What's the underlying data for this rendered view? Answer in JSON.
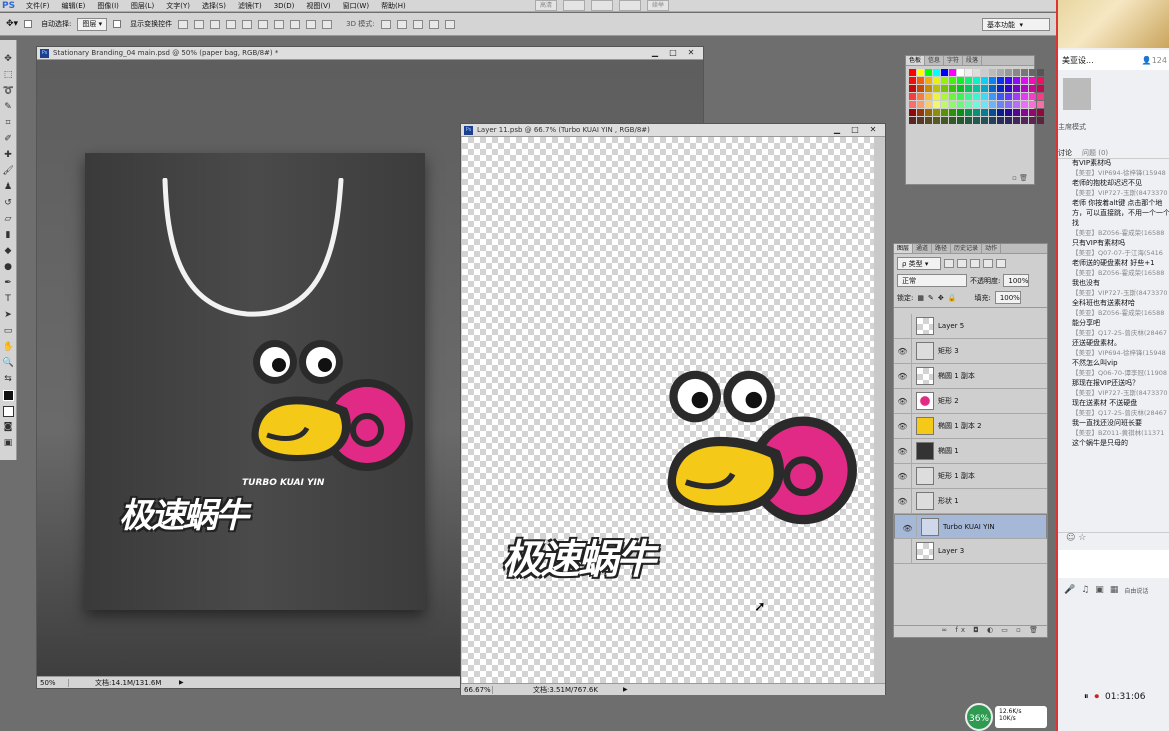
{
  "menubar": {
    "logo": "PS",
    "items": [
      "文件(F)",
      "编辑(E)",
      "图像(I)",
      "图层(L)",
      "文字(Y)",
      "选择(S)",
      "滤镜(T)",
      "3D(D)",
      "视图(V)",
      "窗口(W)",
      "帮助(H)"
    ],
    "top_buttons": [
      "高清",
      "",
      "",
      "",
      "续举"
    ]
  },
  "options": {
    "auto_select_label": "自动选择:",
    "auto_select_value": "图层",
    "transform_label": "显示变换控件",
    "mode_3d_label": "3D 模式:",
    "workspace": "基本功能"
  },
  "doc1": {
    "title": "Stationary Branding_04 main.psd @ 50% (paper bag, RGB/8#) *",
    "zoom": "50%",
    "info": "文档:14.1M/131.6M",
    "brand_en": "TURBO KUAI YIN",
    "brand_cn": "极速蜗牛"
  },
  "doc2": {
    "title": "Layer 11.psb @ 66.7% (Turbo KUAI YIN , RGB/8#)",
    "zoom": "66.67%",
    "info": "文档:3.51M/767.6K",
    "brand_cn": "极速蜗牛"
  },
  "swatches_panel": {
    "tabs": [
      "色板",
      "信息",
      "字符",
      "段落"
    ]
  },
  "layers_panel": {
    "tabs": [
      "图层",
      "通道",
      "路径",
      "历史记录",
      "动作"
    ],
    "kind_label": "ρ 类型",
    "blend_mode": "正常",
    "opacity_label": "不透明度:",
    "opacity_value": "100%",
    "lock_label": "锁定:",
    "fill_label": "填充:",
    "fill_value": "100%",
    "layers": [
      {
        "name": "Layer 5",
        "visible": false
      },
      {
        "name": "矩形 3",
        "visible": true
      },
      {
        "name": "椭圆 1 副本",
        "visible": true
      },
      {
        "name": "矩形 2",
        "visible": true
      },
      {
        "name": "椭圆 1 副本 2",
        "visible": true
      },
      {
        "name": "椭圆 1",
        "visible": true
      },
      {
        "name": "矩形 1 副本",
        "visible": true
      },
      {
        "name": "形状 1",
        "visible": true
      },
      {
        "name": "Turbo KUAI YIN",
        "visible": true,
        "selected": true
      },
      {
        "name": "Layer 3",
        "visible": false
      }
    ],
    "bottom_icons": "∞ fx ◘ ◐ ▭ ▫ 🗑"
  },
  "tray": {
    "cpu": "36%",
    "up": "12.6K/s",
    "down": "10K/s"
  },
  "side": {
    "title": "美亚设...",
    "count": "124",
    "mode_label": "主席模式",
    "tabs": [
      "讨论",
      "问题 (0)"
    ],
    "messages": [
      {
        "name": "",
        "text": "有VIP素材吗",
        "partial": true
      },
      {
        "name": "【美亚】VIP694-徐梓锋(15948",
        "text": "老师的抱枕却迟迟不见"
      },
      {
        "name": "【美亚】VIP727-玉斯(8473370",
        "text": "老师 你按着alt键 点击那个地方，可以直接跳，不用一个一个找"
      },
      {
        "name": "【美亚】BZ056-霍成荣(16588",
        "text": "只有VIP有素材吗"
      },
      {
        "name": "【美亚】Q07-07-于江海(5416",
        "text": "老师送的硬盘素材 好些+1"
      },
      {
        "name": "【美亚】BZ056-霍成荣(16588",
        "text": "我也没有"
      },
      {
        "name": "【美亚】VIP727-玉斯(8473370",
        "text": "全科班也有送素材哈"
      },
      {
        "name": "【美亚】BZ056-霍成荣(16588",
        "text": "能分享吧"
      },
      {
        "name": "【美亚】Q17-25-曾庆林(28467",
        "text": "还送硬盘素材。"
      },
      {
        "name": "【美亚】VIP694-徐梓锋(15948",
        "text": "不然怎么叫vip"
      },
      {
        "name": "【美亚】Q06-70-谭李冠(11908",
        "text": "那现在报VIP还送吗？"
      },
      {
        "name": "【美亚】VIP727-玉斯(8473370",
        "text": "现在送素材 不送硬盘"
      },
      {
        "name": "【美亚】Q17-25-曾庆林(28467",
        "text": "我一直找还没问班长要"
      },
      {
        "name": "【美亚】BZ011-黄祺林(11371",
        "text": "这个蜗牛是只母的"
      }
    ],
    "freemic": "自由说话",
    "time": "01:31:06"
  }
}
